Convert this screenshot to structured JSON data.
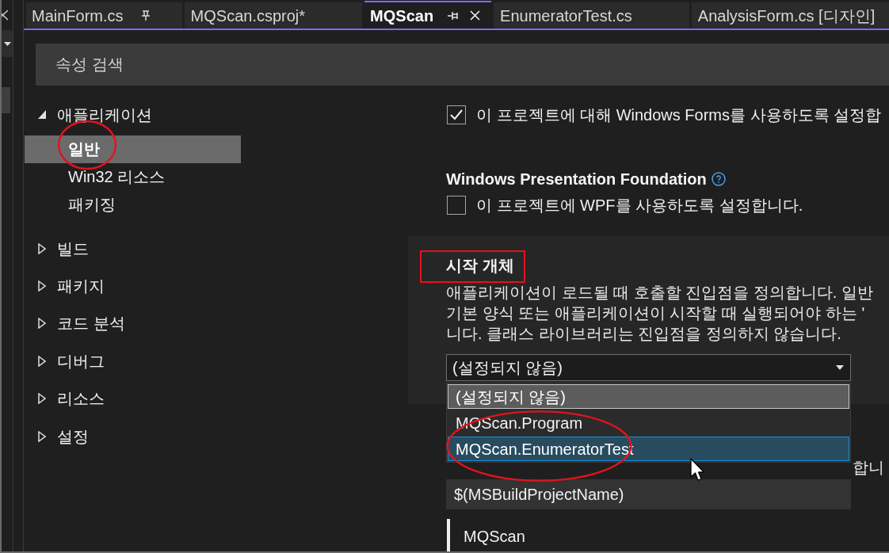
{
  "tabs": [
    {
      "label": "MainForm.cs",
      "selected": false,
      "pinned": true
    },
    {
      "label": "MQScan.csproj*",
      "selected": false,
      "pinned": false
    },
    {
      "label": "MQScan",
      "selected": true,
      "pinned": false
    },
    {
      "label": "EnumeratorTest.cs",
      "selected": false,
      "pinned": false
    },
    {
      "label": "AnalysisForm.cs [디자인]",
      "selected": false,
      "pinned": false
    }
  ],
  "search": {
    "placeholder": "속성 검색"
  },
  "sidebar": {
    "items": [
      {
        "label": "애플리케이션",
        "expanded": true,
        "children": [
          {
            "label": "일반",
            "selected": true,
            "circled": true
          },
          {
            "label": "Win32 리소스",
            "selected": false,
            "circled": false
          },
          {
            "label": "패키징",
            "selected": false,
            "circled": false
          }
        ]
      },
      {
        "label": "빌드",
        "expanded": false
      },
      {
        "label": "패키지",
        "expanded": false
      },
      {
        "label": "코드 분석",
        "expanded": false
      },
      {
        "label": "디버그",
        "expanded": false
      },
      {
        "label": "리소스",
        "expanded": false
      },
      {
        "label": "설정",
        "expanded": false
      }
    ]
  },
  "settings": [
    {
      "kind": "checkbox",
      "label": "이 프로젝트에 대해 Windows Forms를 사용하도록 설정합",
      "checked": true
    },
    {
      "kind": "heading",
      "label": "Windows Presentation Foundation",
      "help": true
    },
    {
      "kind": "checkbox",
      "label": "이 프로젝트에 WPF를 사용하도록 설정합니다.",
      "checked": false
    }
  ],
  "startup_object": {
    "title": "시작 개체",
    "framed": true,
    "description_lines": [
      "애플리케이션이 로드될 때 호출할 진입점을 정의합니다. 일반",
      "기본 양식 또는 애플리케이션이 시작할 때 실행되어야 하는 '",
      "니다. 클래스 라이브러리는 진입점을 정의하지 않습니다."
    ],
    "dropdown": {
      "value": "(설정되지 않음)",
      "expanded": true,
      "circled": true,
      "options": [
        {
          "label": "(설정되지 않음)",
          "selected": true,
          "hovered": false
        },
        {
          "label": "MQScan.Program",
          "selected": false,
          "hovered": false
        },
        {
          "label": "MQScan.EnumeratorTest",
          "selected": false,
          "hovered": true
        }
      ]
    }
  },
  "assembly_name": {
    "description_visible": "합니",
    "value": "$(MSBuildProjectName)",
    "preview": "MQScan"
  }
}
